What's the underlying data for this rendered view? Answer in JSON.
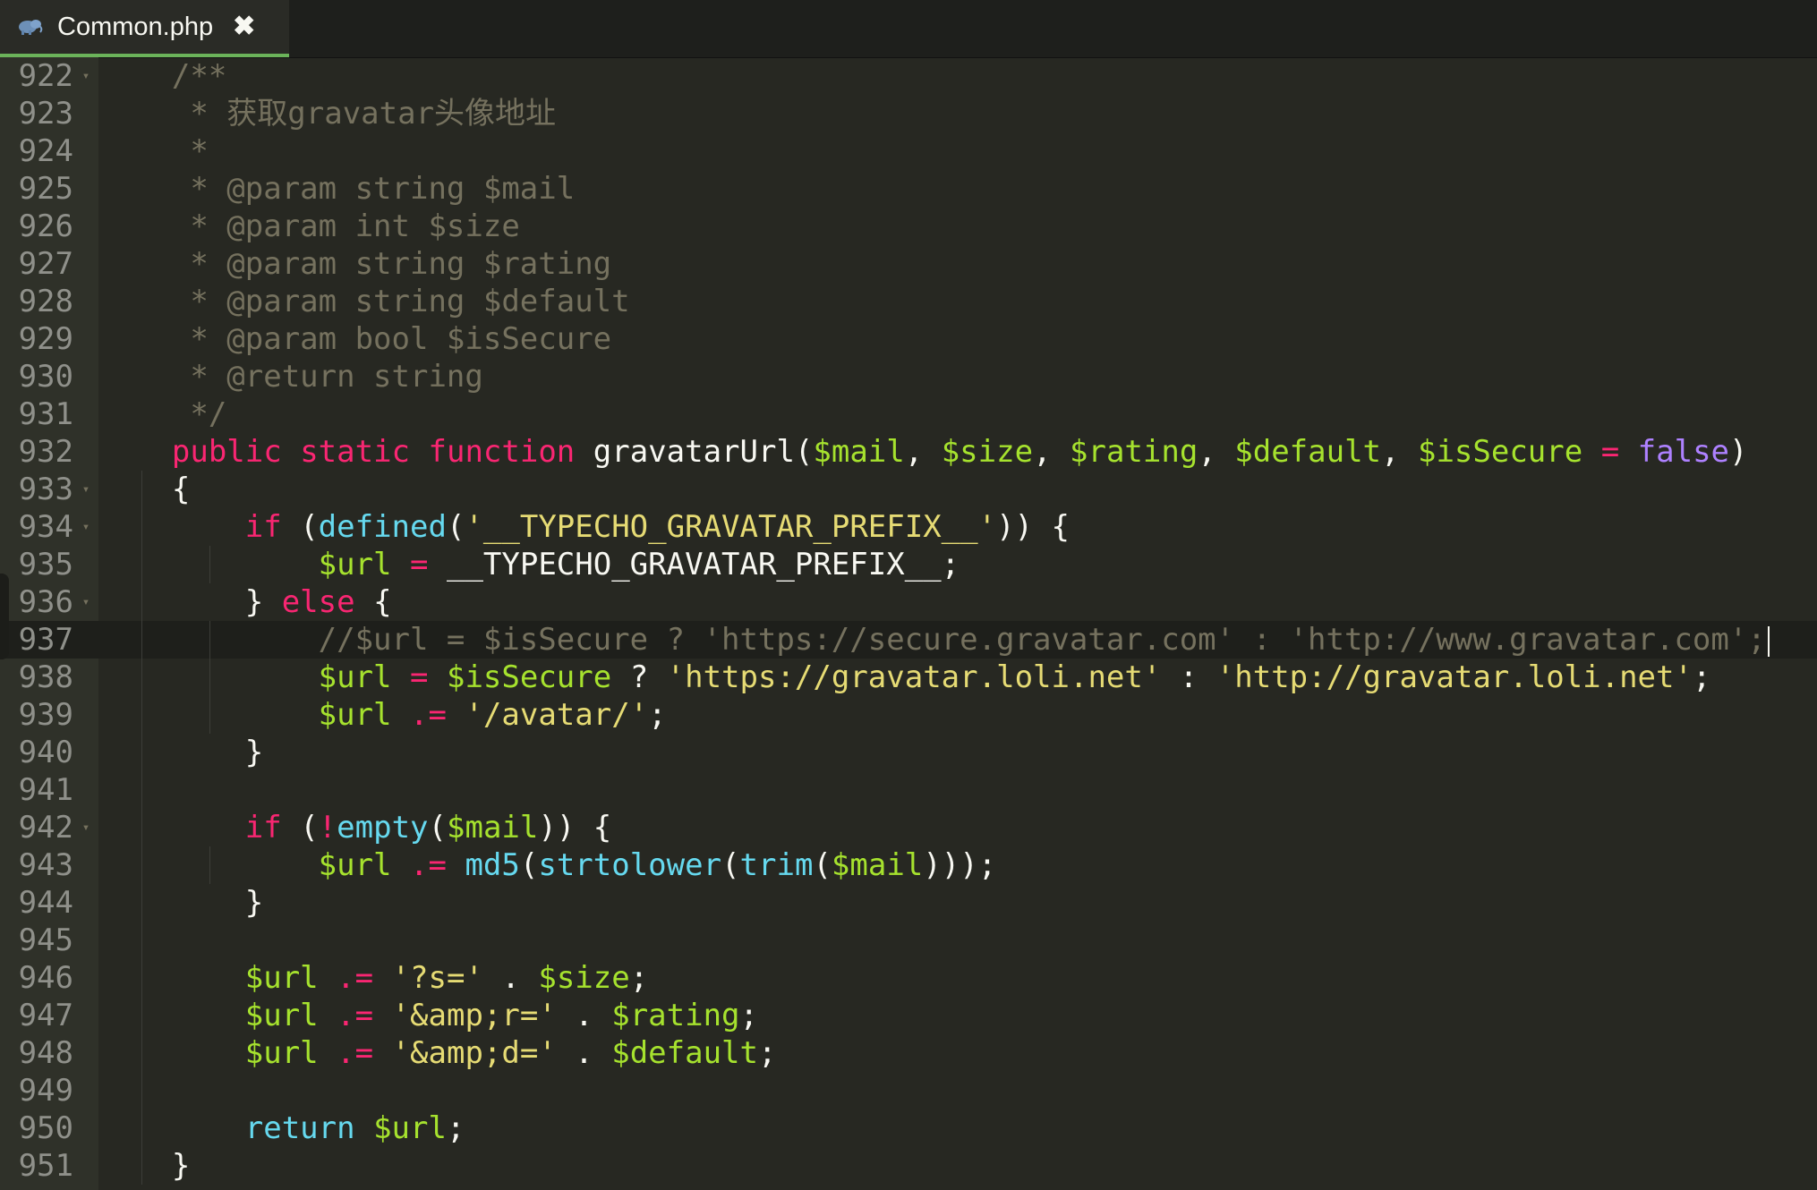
{
  "tab": {
    "title": "Common.php",
    "close_label": "✖",
    "icon": "elephant-icon"
  },
  "editor": {
    "lines": [
      {
        "n": "922",
        "fold": true
      },
      {
        "n": "923"
      },
      {
        "n": "924"
      },
      {
        "n": "925"
      },
      {
        "n": "926"
      },
      {
        "n": "927"
      },
      {
        "n": "928"
      },
      {
        "n": "929"
      },
      {
        "n": "930"
      },
      {
        "n": "931"
      },
      {
        "n": "932"
      },
      {
        "n": "933",
        "fold": true
      },
      {
        "n": "934",
        "fold": true
      },
      {
        "n": "935"
      },
      {
        "n": "936",
        "fold": true
      },
      {
        "n": "937",
        "active": true
      },
      {
        "n": "938"
      },
      {
        "n": "939"
      },
      {
        "n": "940"
      },
      {
        "n": "941"
      },
      {
        "n": "942",
        "fold": true
      },
      {
        "n": "943"
      },
      {
        "n": "944"
      },
      {
        "n": "945"
      },
      {
        "n": "946"
      },
      {
        "n": "947"
      },
      {
        "n": "948"
      },
      {
        "n": "949"
      },
      {
        "n": "950"
      },
      {
        "n": "951"
      }
    ],
    "code": [
      [
        {
          "t": "    /**",
          "c": "comment"
        }
      ],
      [
        {
          "t": "     * 获取gravatar头像地址",
          "c": "comment"
        }
      ],
      [
        {
          "t": "     *",
          "c": "comment"
        }
      ],
      [
        {
          "t": "     * @param string $mail",
          "c": "comment"
        }
      ],
      [
        {
          "t": "     * @param int $size",
          "c": "comment"
        }
      ],
      [
        {
          "t": "     * @param string $rating",
          "c": "comment"
        }
      ],
      [
        {
          "t": "     * @param string $default",
          "c": "comment"
        }
      ],
      [
        {
          "t": "     * @param bool $isSecure",
          "c": "comment"
        }
      ],
      [
        {
          "t": "     * @return string",
          "c": "comment"
        }
      ],
      [
        {
          "t": "     */",
          "c": "comment"
        }
      ],
      [
        {
          "t": "    ",
          "c": "plain"
        },
        {
          "t": "public",
          "c": "keyword"
        },
        {
          "t": " ",
          "c": "plain"
        },
        {
          "t": "static",
          "c": "keyword"
        },
        {
          "t": " ",
          "c": "plain"
        },
        {
          "t": "function",
          "c": "keyword"
        },
        {
          "t": " gravatarUrl(",
          "c": "function"
        },
        {
          "t": "$mail",
          "c": "var"
        },
        {
          "t": ", ",
          "c": "plain"
        },
        {
          "t": "$size",
          "c": "var"
        },
        {
          "t": ", ",
          "c": "plain"
        },
        {
          "t": "$rating",
          "c": "var"
        },
        {
          "t": ", ",
          "c": "plain"
        },
        {
          "t": "$default",
          "c": "var"
        },
        {
          "t": ", ",
          "c": "plain"
        },
        {
          "t": "$isSecure",
          "c": "var"
        },
        {
          "t": " ",
          "c": "plain"
        },
        {
          "t": "=",
          "c": "op"
        },
        {
          "t": " ",
          "c": "plain"
        },
        {
          "t": "false",
          "c": "const"
        },
        {
          "t": ")",
          "c": "plain"
        }
      ],
      [
        {
          "t": "    {",
          "c": "plain"
        }
      ],
      [
        {
          "t": "        ",
          "c": "plain"
        },
        {
          "t": "if",
          "c": "keyword"
        },
        {
          "t": " (",
          "c": "plain"
        },
        {
          "t": "defined",
          "c": "builtin"
        },
        {
          "t": "(",
          "c": "plain"
        },
        {
          "t": "'__TYPECHO_GRAVATAR_PREFIX__'",
          "c": "string"
        },
        {
          "t": ")) {",
          "c": "plain"
        }
      ],
      [
        {
          "t": "            ",
          "c": "plain"
        },
        {
          "t": "$url",
          "c": "var"
        },
        {
          "t": " ",
          "c": "plain"
        },
        {
          "t": "=",
          "c": "op"
        },
        {
          "t": " __TYPECHO_GRAVATAR_PREFIX__;",
          "c": "plain"
        }
      ],
      [
        {
          "t": "        } ",
          "c": "plain"
        },
        {
          "t": "else",
          "c": "keyword"
        },
        {
          "t": " {",
          "c": "plain"
        }
      ],
      [
        {
          "t": "            //$url = $isSecure ? 'https://secure.gravatar.com' : 'http://www.gravatar.com';",
          "c": "comment"
        }
      ],
      [
        {
          "t": "            ",
          "c": "plain"
        },
        {
          "t": "$url",
          "c": "var"
        },
        {
          "t": " ",
          "c": "plain"
        },
        {
          "t": "=",
          "c": "op"
        },
        {
          "t": " ",
          "c": "plain"
        },
        {
          "t": "$isSecure",
          "c": "var"
        },
        {
          "t": " ? ",
          "c": "plain"
        },
        {
          "t": "'https://gravatar.loli.net'",
          "c": "string"
        },
        {
          "t": " : ",
          "c": "plain"
        },
        {
          "t": "'http://gravatar.loli.net'",
          "c": "string"
        },
        {
          "t": ";",
          "c": "plain"
        }
      ],
      [
        {
          "t": "            ",
          "c": "plain"
        },
        {
          "t": "$url",
          "c": "var"
        },
        {
          "t": " ",
          "c": "plain"
        },
        {
          "t": ".=",
          "c": "op"
        },
        {
          "t": " ",
          "c": "plain"
        },
        {
          "t": "'/avatar/'",
          "c": "string"
        },
        {
          "t": ";",
          "c": "plain"
        }
      ],
      [
        {
          "t": "        }",
          "c": "plain"
        }
      ],
      [
        {
          "t": "",
          "c": "plain"
        }
      ],
      [
        {
          "t": "        ",
          "c": "plain"
        },
        {
          "t": "if",
          "c": "keyword"
        },
        {
          "t": " (",
          "c": "plain"
        },
        {
          "t": "!",
          "c": "op"
        },
        {
          "t": "empty",
          "c": "builtin"
        },
        {
          "t": "(",
          "c": "plain"
        },
        {
          "t": "$mail",
          "c": "var"
        },
        {
          "t": ")) {",
          "c": "plain"
        }
      ],
      [
        {
          "t": "            ",
          "c": "plain"
        },
        {
          "t": "$url",
          "c": "var"
        },
        {
          "t": " ",
          "c": "plain"
        },
        {
          "t": ".=",
          "c": "op"
        },
        {
          "t": " ",
          "c": "plain"
        },
        {
          "t": "md5",
          "c": "builtin"
        },
        {
          "t": "(",
          "c": "plain"
        },
        {
          "t": "strtolower",
          "c": "builtin"
        },
        {
          "t": "(",
          "c": "plain"
        },
        {
          "t": "trim",
          "c": "builtin"
        },
        {
          "t": "(",
          "c": "plain"
        },
        {
          "t": "$mail",
          "c": "var"
        },
        {
          "t": ")));",
          "c": "plain"
        }
      ],
      [
        {
          "t": "        }",
          "c": "plain"
        }
      ],
      [
        {
          "t": "",
          "c": "plain"
        }
      ],
      [
        {
          "t": "        ",
          "c": "plain"
        },
        {
          "t": "$url",
          "c": "var"
        },
        {
          "t": " ",
          "c": "plain"
        },
        {
          "t": ".=",
          "c": "op"
        },
        {
          "t": " ",
          "c": "plain"
        },
        {
          "t": "'?s='",
          "c": "string"
        },
        {
          "t": " . ",
          "c": "plain"
        },
        {
          "t": "$size",
          "c": "var"
        },
        {
          "t": ";",
          "c": "plain"
        }
      ],
      [
        {
          "t": "        ",
          "c": "plain"
        },
        {
          "t": "$url",
          "c": "var"
        },
        {
          "t": " ",
          "c": "plain"
        },
        {
          "t": ".=",
          "c": "op"
        },
        {
          "t": " ",
          "c": "plain"
        },
        {
          "t": "'&amp;r='",
          "c": "string"
        },
        {
          "t": " . ",
          "c": "plain"
        },
        {
          "t": "$rating",
          "c": "var"
        },
        {
          "t": ";",
          "c": "plain"
        }
      ],
      [
        {
          "t": "        ",
          "c": "plain"
        },
        {
          "t": "$url",
          "c": "var"
        },
        {
          "t": " ",
          "c": "plain"
        },
        {
          "t": ".=",
          "c": "op"
        },
        {
          "t": " ",
          "c": "plain"
        },
        {
          "t": "'&amp;d='",
          "c": "string"
        },
        {
          "t": " . ",
          "c": "plain"
        },
        {
          "t": "$default",
          "c": "var"
        },
        {
          "t": ";",
          "c": "plain"
        }
      ],
      [
        {
          "t": "",
          "c": "plain"
        }
      ],
      [
        {
          "t": "        ",
          "c": "plain"
        },
        {
          "t": "return",
          "c": "storage"
        },
        {
          "t": " ",
          "c": "plain"
        },
        {
          "t": "$url",
          "c": "var"
        },
        {
          "t": ";",
          "c": "plain"
        }
      ],
      [
        {
          "t": "    }",
          "c": "plain"
        }
      ]
    ]
  },
  "colors": {
    "background": "#272822",
    "gutter": "#2f3129",
    "active_line": "#1e1f1b",
    "tab_underline": "#6bb35a"
  }
}
